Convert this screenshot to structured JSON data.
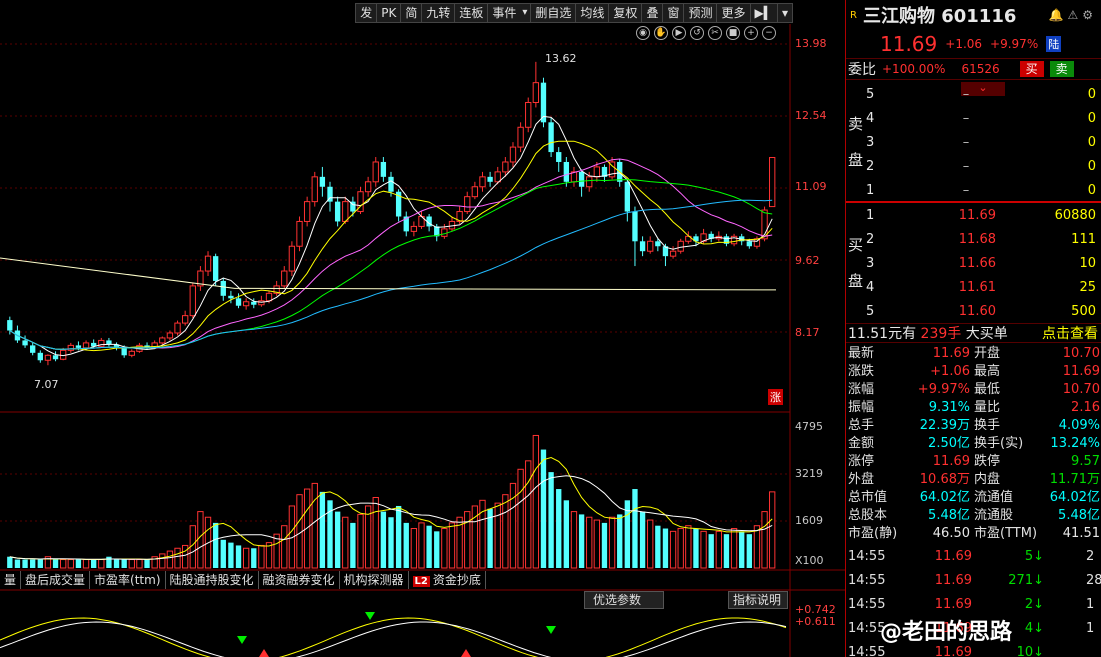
{
  "toolbar": [
    "发",
    "PK",
    "简",
    "九转",
    "连板",
    "事件",
    "删自选",
    "均线",
    "复权",
    "叠",
    "窗",
    "预测",
    "更多"
  ],
  "price_axis": [
    "13.98",
    "12.54",
    "11.09",
    "9.62",
    "8.17"
  ],
  "chart_labels": {
    "high": "13.62",
    "low": "7.07",
    "zhang": "涨"
  },
  "volume_axis": [
    "4795",
    "3219",
    "1609",
    "X100"
  ],
  "indicator_axis": [
    "+0.742",
    "+0.611"
  ],
  "bottom_tabs": [
    "量",
    "盘后成交量",
    "市盈率(ttm)",
    "陆股通持股变化",
    "融资融券变化",
    "机构探测器",
    "资金抄底"
  ],
  "l2_badge": "L2",
  "optimize_button": "优选参数",
  "indicator_help": "指标说明",
  "stock": {
    "r_badge": "R",
    "name": "三江购物 601116",
    "last": "11.69",
    "change": "+1.06",
    "pct": "+9.97%",
    "tag": "陆"
  },
  "weibi": {
    "label": "委比",
    "pct": "+100.00%",
    "diff": "61526",
    "buy": "买",
    "sell": "卖"
  },
  "sell_label": [
    "卖",
    "盘"
  ],
  "buy_label": [
    "买",
    "盘"
  ],
  "sell_book": [
    {
      "lv": "5",
      "p": "–",
      "v": "0"
    },
    {
      "lv": "4",
      "p": "–",
      "v": "0"
    },
    {
      "lv": "3",
      "p": "–",
      "v": "0"
    },
    {
      "lv": "2",
      "p": "–",
      "v": "0"
    },
    {
      "lv": "1",
      "p": "–",
      "v": "0"
    }
  ],
  "buy_book": [
    {
      "lv": "1",
      "p": "11.69",
      "v": "60880"
    },
    {
      "lv": "2",
      "p": "11.68",
      "v": "111"
    },
    {
      "lv": "3",
      "p": "11.66",
      "v": "10"
    },
    {
      "lv": "4",
      "p": "11.61",
      "v": "25"
    },
    {
      "lv": "5",
      "p": "11.60",
      "v": "500"
    }
  ],
  "big_order": {
    "price": "11.51元有",
    "qty": "239手",
    "text": "大买单",
    "link": "点击查看"
  },
  "stats": [
    {
      "k1": "最新",
      "v1": "11.69",
      "c1": "red",
      "k2": "开盘",
      "v2": "10.70",
      "c2": "red"
    },
    {
      "k1": "涨跌",
      "v1": "+1.06",
      "c1": "red",
      "k2": "最高",
      "v2": "11.69",
      "c2": "red"
    },
    {
      "k1": "涨幅",
      "v1": "+9.97%",
      "c1": "red",
      "k2": "最低",
      "v2": "10.70",
      "c2": "red"
    },
    {
      "k1": "振幅",
      "v1": "9.31%",
      "c1": "cyan",
      "k2": "量比",
      "v2": "2.16",
      "c2": "red"
    },
    {
      "k1": "总手",
      "v1": "22.39万",
      "c1": "cyan",
      "k2": "换手",
      "v2": "4.09%",
      "c2": "cyan"
    },
    {
      "k1": "金额",
      "v1": "2.50亿",
      "c1": "cyan",
      "k2": "换手(实)",
      "v2": "13.24%",
      "c2": "cyan"
    },
    {
      "k1": "涨停",
      "v1": "11.69",
      "c1": "red",
      "k2": "跌停",
      "v2": "9.57",
      "c2": "green"
    },
    {
      "k1": "外盘",
      "v1": "10.68万",
      "c1": "red",
      "k2": "内盘",
      "v2": "11.71万",
      "c2": "green"
    },
    {
      "k1": "总市值",
      "v1": "64.02亿",
      "c1": "cyan",
      "k2": "流通值",
      "v2": "64.02亿",
      "c2": "cyan"
    },
    {
      "k1": "总股本",
      "v1": "5.48亿",
      "c1": "cyan",
      "k2": "流通股",
      "v2": "5.48亿",
      "c2": "cyan"
    },
    {
      "k1": "市盈(静)",
      "v1": "46.50",
      "c1": "white",
      "k2": "市盈(TTM)",
      "v2": "41.51",
      "c2": "white"
    }
  ],
  "ticks": [
    {
      "t": "14:55",
      "p": "11.69",
      "v": "5",
      "n": "2"
    },
    {
      "t": "14:55",
      "p": "11.69",
      "v": "271",
      "n": "28"
    },
    {
      "t": "14:55",
      "p": "11.69",
      "v": "2",
      "n": "1"
    },
    {
      "t": "14:55",
      "p": "11.69",
      "v": "4",
      "n": "1"
    },
    {
      "t": "14:55",
      "p": "11.69",
      "v": "10",
      "n": ""
    }
  ],
  "watermark": "@老田的思路",
  "candles": [
    [
      8.41,
      8.2,
      8.48,
      8.12
    ],
    [
      8.2,
      8.0,
      8.3,
      7.95
    ],
    [
      8.0,
      7.9,
      8.1,
      7.85
    ],
    [
      7.9,
      7.75,
      7.95,
      7.7
    ],
    [
      7.75,
      7.6,
      7.8,
      7.55
    ],
    [
      7.6,
      7.7,
      7.72,
      7.5
    ],
    [
      7.7,
      7.62,
      7.78,
      7.58
    ],
    [
      7.62,
      7.8,
      7.85,
      7.6
    ],
    [
      7.8,
      7.9,
      7.95,
      7.75
    ],
    [
      7.9,
      7.85,
      7.98,
      7.8
    ],
    [
      7.85,
      7.95,
      8.0,
      7.82
    ],
    [
      7.95,
      7.88,
      8.02,
      7.84
    ],
    [
      7.88,
      8.0,
      8.05,
      7.86
    ],
    [
      8.0,
      7.92,
      8.05,
      7.88
    ],
    [
      7.92,
      7.85,
      7.96,
      7.8
    ],
    [
      7.85,
      7.7,
      7.9,
      7.65
    ],
    [
      7.7,
      7.78,
      7.82,
      7.66
    ],
    [
      7.78,
      7.9,
      7.95,
      7.75
    ],
    [
      7.9,
      7.85,
      7.96,
      7.82
    ],
    [
      7.85,
      7.95,
      8.0,
      7.83
    ],
    [
      7.95,
      8.05,
      8.08,
      7.92
    ],
    [
      8.05,
      8.15,
      8.2,
      8.0
    ],
    [
      8.15,
      8.35,
      8.4,
      8.1
    ],
    [
      8.35,
      8.5,
      8.6,
      8.3
    ],
    [
      8.5,
      9.1,
      9.15,
      8.45
    ],
    [
      9.1,
      9.4,
      9.5,
      9.0
    ],
    [
      9.4,
      9.7,
      9.8,
      9.3
    ],
    [
      9.7,
      9.2,
      9.75,
      9.1
    ],
    [
      9.2,
      8.9,
      9.25,
      8.8
    ],
    [
      8.9,
      8.85,
      9.0,
      8.75
    ],
    [
      8.85,
      8.7,
      8.95,
      8.65
    ],
    [
      8.7,
      8.78,
      8.85,
      8.62
    ],
    [
      8.78,
      8.72,
      8.85,
      8.65
    ],
    [
      8.72,
      8.8,
      8.9,
      8.68
    ],
    [
      8.8,
      8.95,
      9.0,
      8.75
    ],
    [
      8.95,
      9.1,
      9.2,
      8.9
    ],
    [
      9.1,
      9.4,
      9.5,
      9.05
    ],
    [
      9.4,
      9.9,
      10.0,
      9.3
    ],
    [
      9.9,
      10.4,
      10.5,
      9.8
    ],
    [
      10.4,
      10.8,
      10.9,
      10.3
    ],
    [
      10.8,
      11.3,
      11.4,
      10.7
    ],
    [
      11.3,
      11.1,
      11.5,
      10.9
    ],
    [
      11.1,
      10.8,
      11.2,
      10.6
    ],
    [
      10.8,
      10.4,
      10.9,
      10.3
    ],
    [
      10.4,
      10.8,
      10.9,
      10.35
    ],
    [
      10.8,
      10.6,
      10.9,
      10.5
    ],
    [
      10.6,
      11.0,
      11.1,
      10.55
    ],
    [
      11.0,
      11.2,
      11.3,
      10.9
    ],
    [
      11.2,
      11.6,
      11.7,
      11.1
    ],
    [
      11.6,
      11.3,
      11.7,
      11.2
    ],
    [
      11.3,
      11.0,
      11.4,
      10.9
    ],
    [
      11.0,
      10.5,
      11.05,
      10.4
    ],
    [
      10.5,
      10.2,
      10.6,
      10.1
    ],
    [
      10.2,
      10.3,
      10.4,
      10.1
    ],
    [
      10.3,
      10.5,
      10.6,
      10.25
    ],
    [
      10.5,
      10.3,
      10.55,
      10.2
    ],
    [
      10.3,
      10.1,
      10.35,
      10.0
    ],
    [
      10.1,
      10.25,
      10.35,
      10.05
    ],
    [
      10.25,
      10.4,
      10.5,
      10.2
    ],
    [
      10.4,
      10.6,
      10.7,
      10.35
    ],
    [
      10.6,
      10.9,
      11.0,
      10.55
    ],
    [
      10.9,
      11.1,
      11.2,
      10.85
    ],
    [
      11.1,
      11.3,
      11.4,
      11.0
    ],
    [
      11.3,
      11.2,
      11.4,
      11.1
    ],
    [
      11.2,
      11.4,
      11.5,
      11.15
    ],
    [
      11.4,
      11.6,
      11.7,
      11.3
    ],
    [
      11.6,
      11.9,
      12.0,
      11.5
    ],
    [
      11.9,
      12.3,
      12.4,
      11.8
    ],
    [
      12.3,
      12.8,
      12.9,
      12.2
    ],
    [
      12.8,
      13.2,
      13.62,
      12.7
    ],
    [
      13.2,
      12.4,
      13.3,
      12.3
    ],
    [
      12.4,
      11.8,
      12.5,
      11.7
    ],
    [
      11.8,
      11.6,
      11.9,
      11.4
    ],
    [
      11.6,
      11.2,
      11.7,
      11.1
    ],
    [
      11.2,
      11.4,
      11.5,
      11.1
    ],
    [
      11.4,
      11.1,
      11.45,
      10.9
    ],
    [
      11.1,
      11.3,
      11.4,
      11.0
    ],
    [
      11.3,
      11.5,
      11.6,
      11.2
    ],
    [
      11.5,
      11.3,
      11.55,
      11.2
    ],
    [
      11.3,
      11.6,
      11.7,
      11.25
    ],
    [
      11.6,
      11.2,
      11.65,
      11.1
    ],
    [
      11.2,
      10.6,
      11.25,
      10.4
    ],
    [
      10.6,
      10.0,
      10.7,
      9.5
    ],
    [
      10.0,
      9.8,
      10.1,
      9.7
    ],
    [
      9.8,
      10.0,
      10.1,
      9.75
    ],
    [
      10.0,
      9.9,
      10.05,
      9.8
    ],
    [
      9.9,
      9.7,
      9.95,
      9.5
    ],
    [
      9.7,
      9.8,
      9.9,
      9.65
    ],
    [
      9.8,
      10.0,
      10.05,
      9.75
    ],
    [
      10.0,
      10.1,
      10.2,
      9.95
    ],
    [
      10.1,
      10.0,
      10.15,
      9.9
    ],
    [
      10.0,
      10.15,
      10.25,
      9.95
    ],
    [
      10.15,
      10.05,
      10.2,
      9.98
    ],
    [
      10.05,
      10.1,
      10.2,
      10.0
    ],
    [
      10.1,
      9.95,
      10.15,
      9.9
    ],
    [
      9.95,
      10.1,
      10.15,
      9.9
    ],
    [
      10.1,
      10.0,
      10.15,
      9.92
    ],
    [
      10.0,
      9.9,
      10.05,
      9.85
    ],
    [
      9.9,
      10.05,
      10.1,
      9.85
    ],
    [
      10.05,
      10.63,
      10.7,
      10.0
    ],
    [
      10.7,
      11.69,
      11.69,
      10.7
    ]
  ],
  "volumes": [
    4,
    3,
    3,
    3,
    3,
    4,
    3,
    3,
    3,
    3,
    3,
    3,
    3,
    4,
    3,
    3,
    3,
    3,
    3,
    4,
    5,
    6,
    7,
    8,
    15,
    20,
    18,
    16,
    10,
    9,
    8,
    7,
    7,
    8,
    9,
    12,
    15,
    22,
    26,
    28,
    30,
    27,
    24,
    20,
    18,
    16,
    19,
    22,
    25,
    20,
    18,
    22,
    16,
    14,
    16,
    15,
    13,
    14,
    16,
    18,
    20,
    22,
    24,
    21,
    23,
    26,
    30,
    35,
    38,
    47,
    42,
    34,
    28,
    24,
    20,
    19,
    18,
    17,
    16,
    18,
    19,
    24,
    28,
    20,
    17,
    15,
    14,
    13,
    14,
    15,
    14,
    13,
    12,
    13,
    12,
    14,
    13,
    12,
    15,
    20,
    27
  ]
}
